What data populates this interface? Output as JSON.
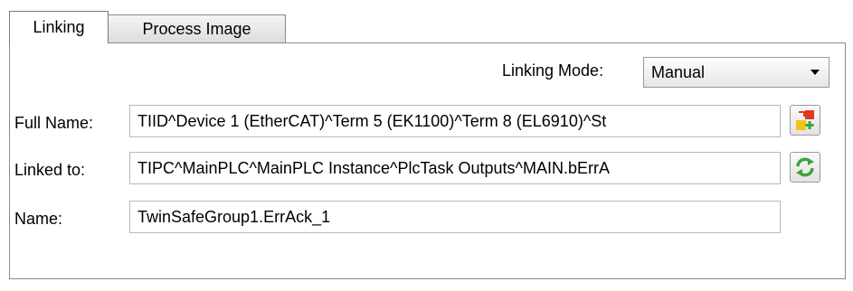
{
  "tabs": [
    {
      "label": "Linking",
      "active": true
    },
    {
      "label": "Process Image",
      "active": false
    }
  ],
  "linking_mode": {
    "label": "Linking Mode:",
    "value": "Manual"
  },
  "full_name": {
    "label": "Full Name:",
    "value": "TIID^Device 1 (EtherCAT)^Term 5 (EK1100)^Term 8 (EL6910)^St"
  },
  "linked_to": {
    "label": "Linked to:",
    "value": "TIPC^MainPLC^MainPLC Instance^PlcTask Outputs^MAIN.bErrA"
  },
  "name": {
    "label": "Name:",
    "value": "TwinSafeGroup1.ErrAck_1"
  },
  "icons": {
    "full_name_button": "add-link-icon",
    "linked_to_button": "refresh-link-icon",
    "combo_arrow": "chevron-down-icon"
  },
  "colors": {
    "green_icon": "#3aa53a",
    "red_icon": "#e03a1e",
    "yellow_icon": "#f2c21a"
  }
}
